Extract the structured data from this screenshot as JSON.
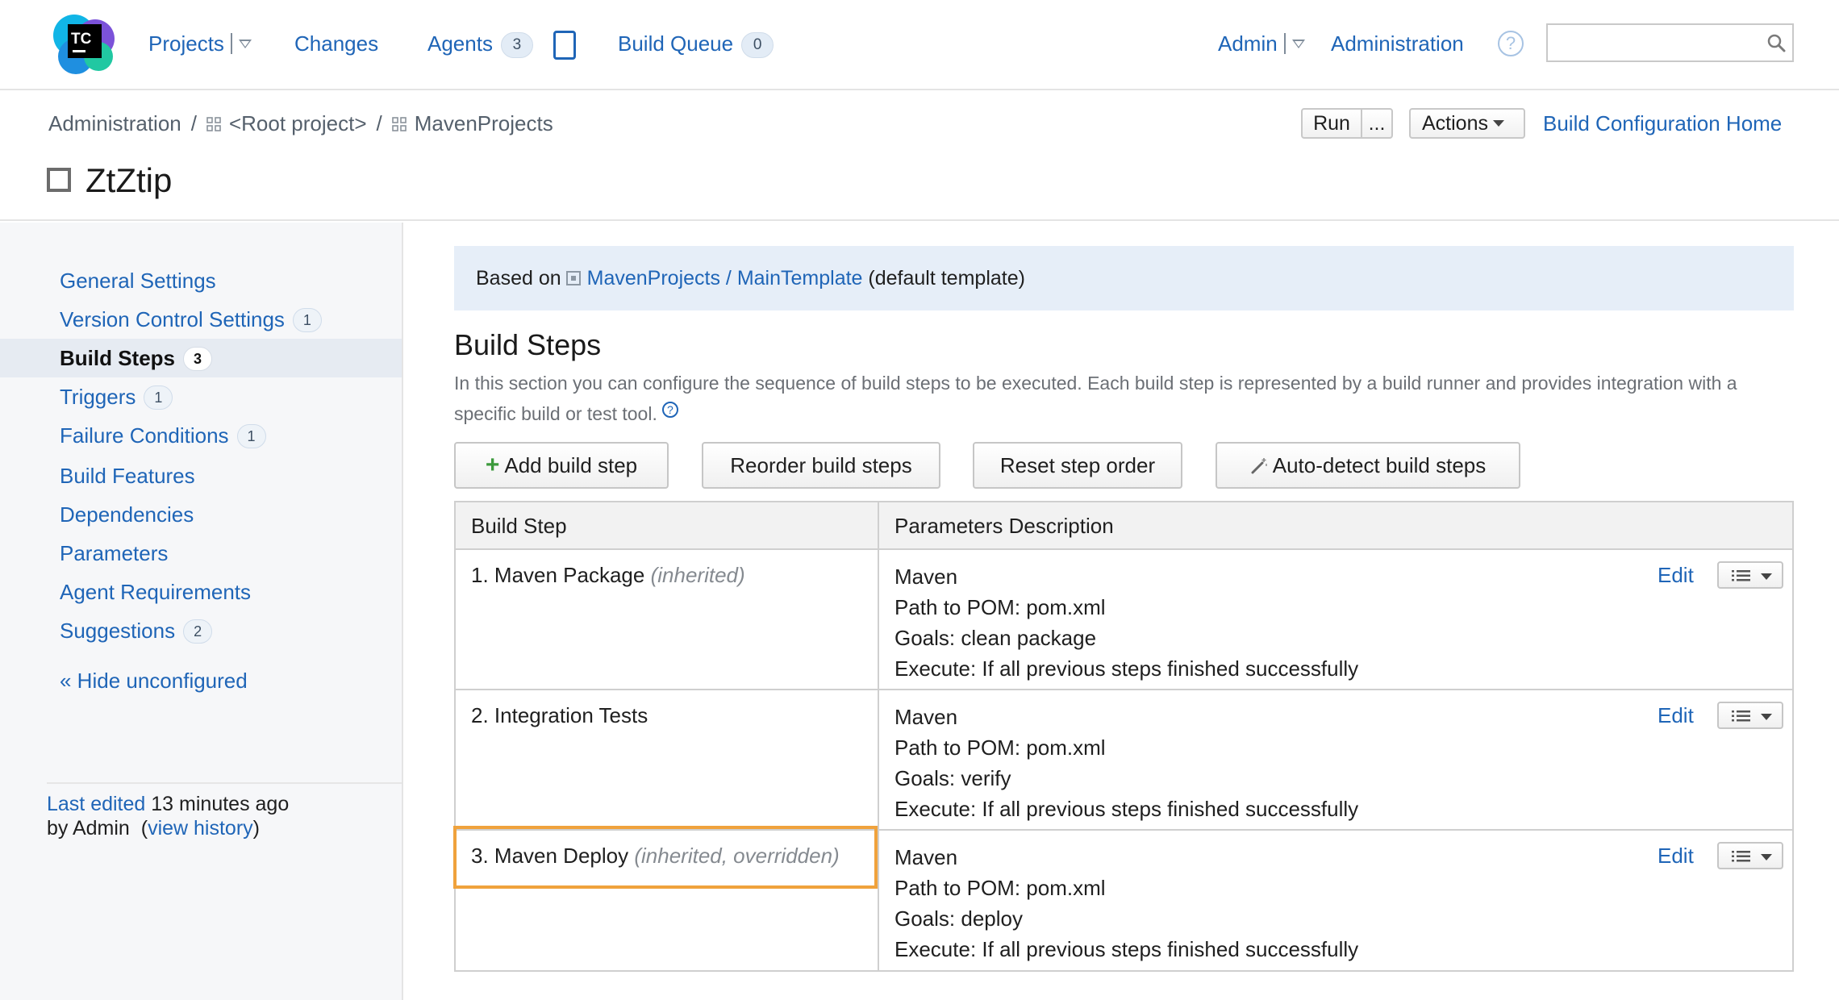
{
  "header": {
    "logo_text": "TC",
    "nav": {
      "projects": "Projects",
      "changes": "Changes",
      "agents": "Agents",
      "agents_count": "3",
      "build_queue": "Build Queue",
      "build_queue_count": "0",
      "admin": "Admin",
      "administration": "Administration"
    },
    "help_glyph": "?",
    "search_value": "",
    "icons": [
      "tc-logo-icon",
      "dropdown-triangle-icon",
      "agent-device-icon",
      "help-icon",
      "search-icon"
    ]
  },
  "breadcrumb": {
    "items": [
      "Administration",
      "<Root project>",
      "MavenProjects"
    ],
    "separator": "/"
  },
  "page": {
    "title": "ZtZtip",
    "run_label": "Run",
    "run_more_label": "...",
    "actions_label": "Actions",
    "home_link": "Build Configuration Home"
  },
  "sidebar": {
    "items": [
      {
        "label": "General Settings",
        "count": ""
      },
      {
        "label": "Version Control Settings",
        "count": "1"
      },
      {
        "label": "Build Steps",
        "count": "3",
        "active": true
      },
      {
        "label": "Triggers",
        "count": "1"
      },
      {
        "label": "Failure Conditions",
        "count": "1"
      },
      {
        "label": "Build Features",
        "count": ""
      },
      {
        "label": "Dependencies",
        "count": ""
      },
      {
        "label": "Parameters",
        "count": ""
      },
      {
        "label": "Agent Requirements",
        "count": ""
      },
      {
        "label": "Suggestions",
        "count": "2"
      }
    ],
    "hide_unconfigured": "« Hide unconfigured",
    "last_edited_link": "Last edited",
    "last_edited_time": "13 minutes ago",
    "by_user": "by Admin",
    "view_history": "view history"
  },
  "banner": {
    "prefix": "Based on",
    "template_link": "MavenProjects / MainTemplate",
    "suffix": "(default template)"
  },
  "section": {
    "title": "Build Steps",
    "description": "In this section you can configure the sequence of build steps to be executed. Each build step is represented by a build runner and provides integration with a specific build or test tool."
  },
  "buttons": {
    "add": "Add build step",
    "reorder": "Reorder build steps",
    "reset": "Reset step order",
    "autodetect": "Auto-detect build steps"
  },
  "table": {
    "headers": [
      "Build Step",
      "Parameters Description"
    ],
    "edit_label": "Edit",
    "rows": [
      {
        "name": "1. Maven Package",
        "note": "(inherited)",
        "params": [
          "Maven",
          "Path to POM: pom.xml",
          "Goals: clean package",
          "Execute: If all previous steps finished successfully"
        ]
      },
      {
        "name": "2. Integration Tests",
        "note": "",
        "params": [
          "Maven",
          "Path to POM: pom.xml",
          "Goals: verify",
          "Execute: If all previous steps finished successfully"
        ]
      },
      {
        "name": "3. Maven Deploy",
        "note": "(inherited, overridden)",
        "params": [
          "Maven",
          "Path to POM: pom.xml",
          "Goals: deploy",
          "Execute: If all previous steps finished successfully"
        ]
      }
    ]
  },
  "colors": {
    "link": "#1f65b7",
    "highlight": "#f0a23c",
    "banner_bg": "#e6eef8",
    "sidebar_bg": "#f6f7f9"
  }
}
